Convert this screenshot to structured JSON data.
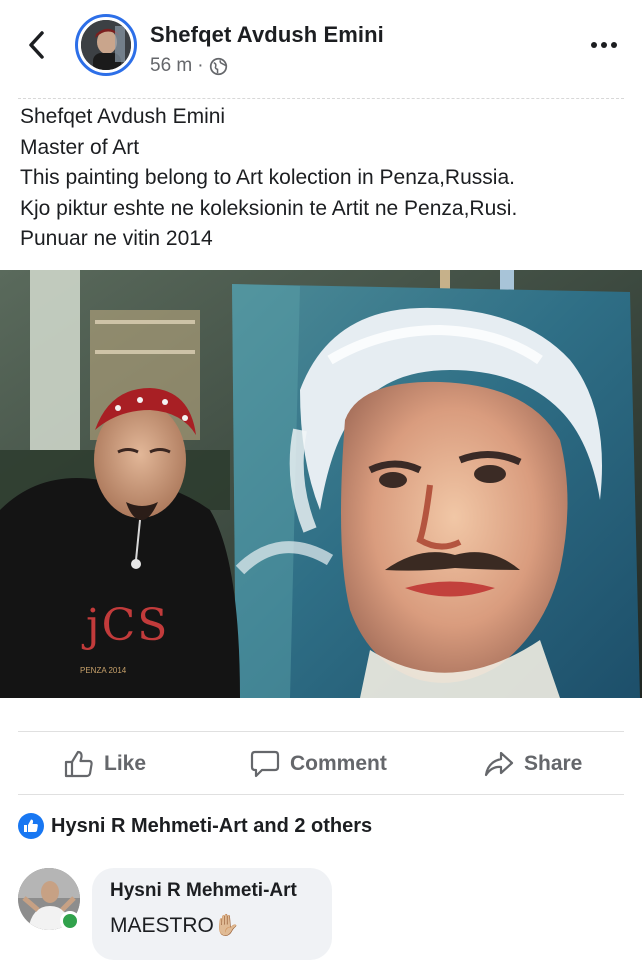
{
  "header": {
    "author_name": "Shefqet Avdush Emini",
    "timestamp": "56 m",
    "separator": "·",
    "privacy_icon": "globe-icon",
    "back_icon": "chevron-left-icon",
    "more_icon": "more-horizontal-icon"
  },
  "post": {
    "lines": [
      "Shefqet Avdush Emini",
      "Master of Art",
      "This painting belong to Art kolection in Penza,Russia.",
      "Kjo piktur eshte ne koleksionin te Artit ne Penza,Rusi.",
      "Punuar ne vitin 2014"
    ],
    "shirt_text": "jCS",
    "shirt_caption": "PENZA 2014"
  },
  "actions": {
    "like_label": "Like",
    "comment_label": "Comment",
    "share_label": "Share"
  },
  "reactions": {
    "icon": "thumbs-up-icon",
    "summary": "Hysni R Mehmeti-Art and 2 others"
  },
  "comment": {
    "author": "Hysni R Mehmeti-Art",
    "text": "MAESTRO✋🏼",
    "online": true
  },
  "colors": {
    "accent": "#1877f2",
    "avatar_ring": "#2d6fe8",
    "muted_text": "#65676b",
    "online": "#31a24c",
    "bubble": "#f0f2f5"
  }
}
